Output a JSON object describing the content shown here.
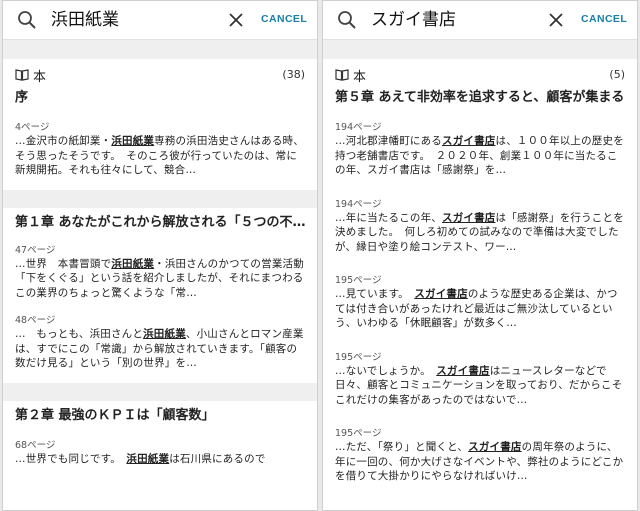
{
  "left": {
    "query": "浜田紙業",
    "cancel_label": "CANCEL",
    "book_label": "本",
    "book_count": "(38)",
    "sections": [
      {
        "title": "序",
        "hits": [
          {
            "page": "4ページ",
            "pre": "…金沢市の紙卸業・",
            "highlight": "浜田紙業",
            "post": "専務の浜田浩史さんはある時、そう思ったそうです。　そのころ彼が行っていたのは、常に新規開拓。それも往々にして、競合…"
          }
        ]
      },
      {
        "title": "第１章 あなたがこれから解放される「５つの不…",
        "hits": [
          {
            "page": "47ページ",
            "pre": "…世界　本書冒頭で",
            "highlight": "浜田紙業",
            "post": "・浜田さんのかつての営業活動「下をくぐる」という話を紹介しましたが、それにまつわるこの業界のちょっと驚くような「常…"
          },
          {
            "page": "48ページ",
            "pre": "…　もっとも、浜田さんと",
            "highlight": "浜田紙業",
            "post": "、小山さんとロマン産業は、すでにこの「常識」から解放されていきます。「顧客の数だけ見る」という「別の世界」を…"
          }
        ]
      },
      {
        "title": "第２章 最強のＫＰＩは「顧客数」",
        "hits": [
          {
            "page": "68ページ",
            "pre": "…世界でも同じです。　",
            "highlight": "浜田紙業",
            "post": "は石川県にあるので"
          }
        ]
      }
    ]
  },
  "right": {
    "query": "スガイ書店",
    "cancel_label": "CANCEL",
    "book_label": "本",
    "book_count": "(5)",
    "sections": [
      {
        "title": "第５章 あえて非効率を追求すると、顧客が集まる",
        "hits": [
          {
            "page": "194ページ",
            "pre": "…河北郡津幡町にある",
            "highlight": "スガイ書店",
            "post": "は、１００年以上の歴史を持つ老舗書店です。　２０２０年、創業１００年に当たるこの年、スガイ書店は「感謝祭」を…"
          },
          {
            "page": "194ページ",
            "pre": "…年に当たるこの年、",
            "highlight": "スガイ書店",
            "post": "は「感謝祭」を行うことを決めました。　何しろ初めての試みなので準備は大変でしたが、縁日や塗り絵コンテスト、ワー…"
          },
          {
            "page": "195ページ",
            "pre": "…見ています。　",
            "highlight": "スガイ書店",
            "post": "のような歴史ある企業は、かつては付き合いがあったけれど最近はご無沙汰しているという、いわゆる「休眠顧客」が数多く…"
          },
          {
            "page": "195ページ",
            "pre": "…ないでしょうか。　",
            "highlight": "スガイ書店",
            "post": "はニュースレターなどで日々、顧客とコミュニケーションを取っており、だからこそこれだけの集客があったのではないで…"
          },
          {
            "page": "195ページ",
            "pre": "…ただ、「祭り」と聞くと、",
            "highlight": "スガイ書店",
            "post": "の周年祭のように、年に一回の、何か大げさなイベントや、弊社のようにどこかを借りて大掛かりにやらなければいけ…"
          }
        ]
      }
    ]
  },
  "colors": {
    "cancel": "#1a7fa6",
    "band": "#efefef"
  },
  "icons": {
    "search": "search-icon",
    "clear": "close-icon",
    "book": "book-icon"
  }
}
